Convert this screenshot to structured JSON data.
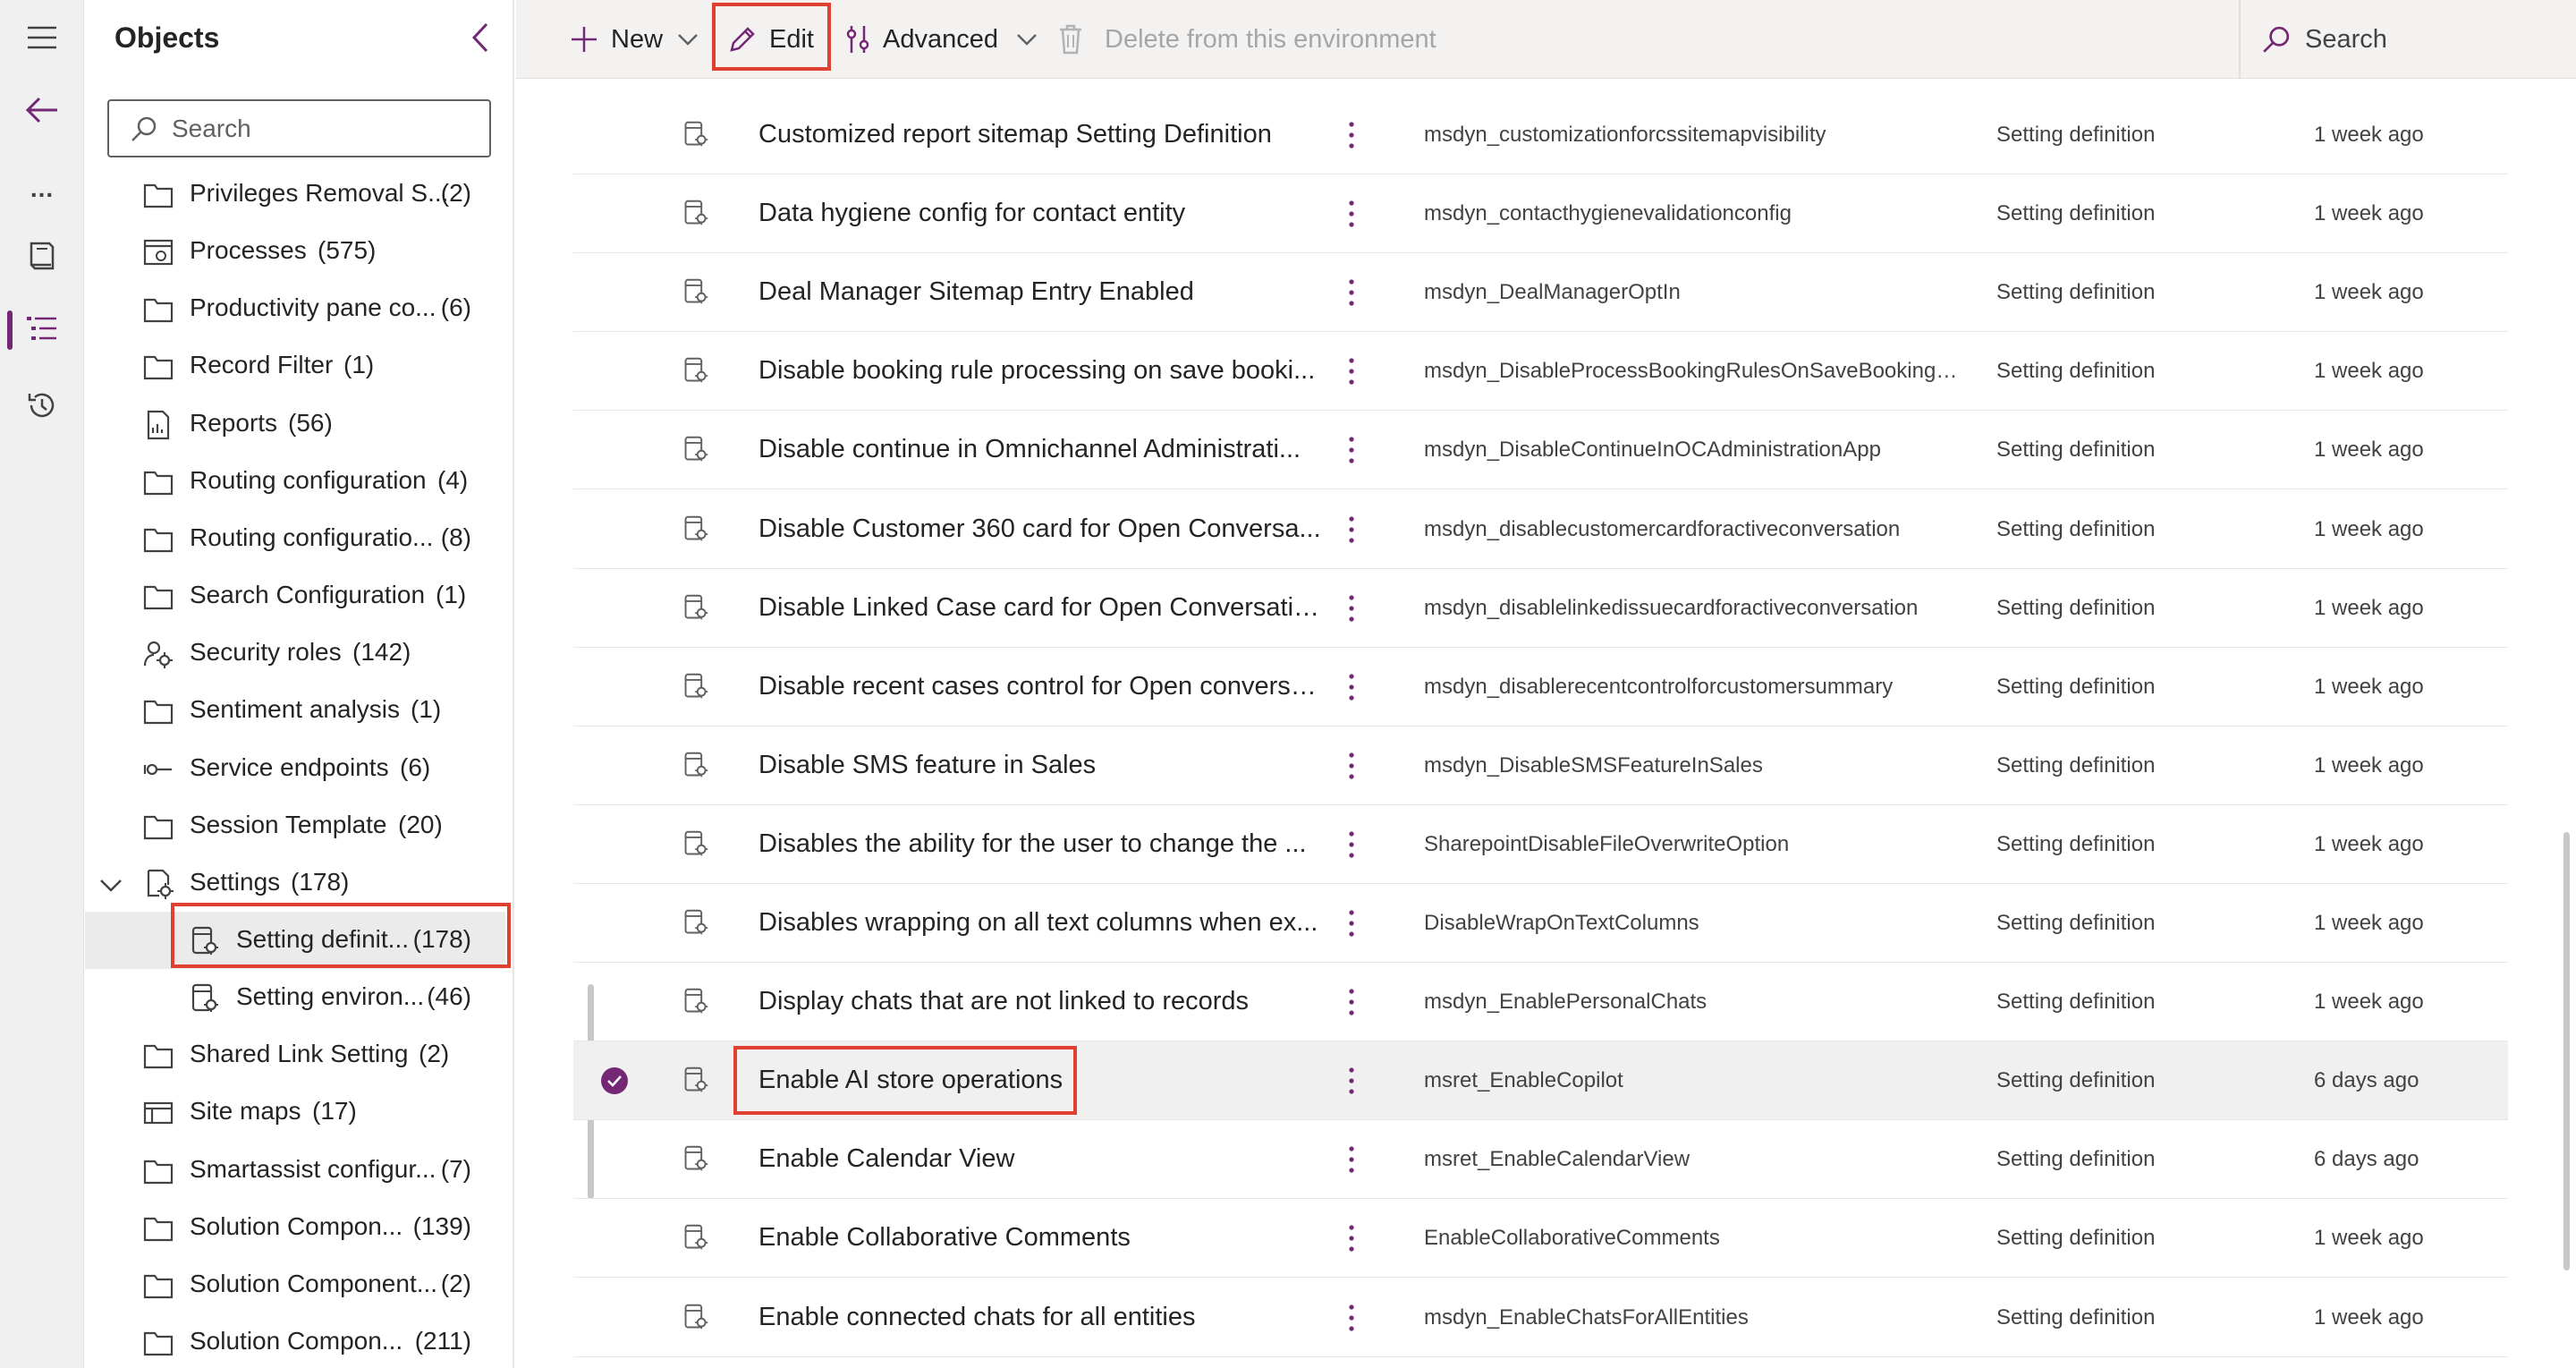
{
  "colors": {
    "accent": "#742774",
    "highlight": "#e0402f"
  },
  "rail": {
    "items": [
      {
        "icon": "hamburger-menu-icon"
      },
      {
        "icon": "back-arrow-icon"
      },
      {
        "icon": "more-options-icon",
        "label": "..."
      },
      {
        "icon": "book-icon"
      },
      {
        "icon": "object-list-icon",
        "active": true
      },
      {
        "icon": "history-icon"
      }
    ]
  },
  "objects": {
    "title": "Objects",
    "search_placeholder": "Search",
    "items": [
      {
        "label": "Privileges Removal S...",
        "count": "(2)",
        "icon": "folder-icon"
      },
      {
        "label": "Processes",
        "count": "(575)",
        "icon": "process-icon"
      },
      {
        "label": "Productivity pane co...",
        "count": "(6)",
        "icon": "folder-icon"
      },
      {
        "label": "Record Filter",
        "count": "(1)",
        "icon": "folder-icon"
      },
      {
        "label": "Reports",
        "count": "(56)",
        "icon": "report-icon"
      },
      {
        "label": "Routing configuration",
        "count": "(4)",
        "icon": "folder-icon"
      },
      {
        "label": "Routing configuratio...",
        "count": "(8)",
        "icon": "folder-icon"
      },
      {
        "label": "Search Configuration",
        "count": "(1)",
        "icon": "folder-icon"
      },
      {
        "label": "Security roles",
        "count": "(142)",
        "icon": "security-roles-icon"
      },
      {
        "label": "Sentiment analysis",
        "count": "(1)",
        "icon": "folder-icon"
      },
      {
        "label": "Service endpoints",
        "count": "(6)",
        "icon": "service-endpoint-icon"
      },
      {
        "label": "Session Template",
        "count": "(20)",
        "icon": "folder-icon"
      },
      {
        "label": "Settings",
        "count": "(178)",
        "icon": "settings-icon",
        "expanded": true
      },
      {
        "label": "Setting definit...",
        "count": "(178)",
        "icon": "setting-definition-icon",
        "child": true,
        "selected": true
      },
      {
        "label": "Setting environ...",
        "count": "(46)",
        "icon": "setting-definition-icon",
        "child": true
      },
      {
        "label": "Shared Link Setting",
        "count": "(2)",
        "icon": "folder-icon"
      },
      {
        "label": "Site maps",
        "count": "(17)",
        "icon": "sitemap-icon"
      },
      {
        "label": "Smartassist configur...",
        "count": "(7)",
        "icon": "folder-icon"
      },
      {
        "label": "Solution Compon...",
        "count": "(139)",
        "icon": "folder-icon"
      },
      {
        "label": "Solution Component...",
        "count": "(2)",
        "icon": "folder-icon"
      },
      {
        "label": "Solution Compon...",
        "count": "(211)",
        "icon": "folder-icon"
      }
    ]
  },
  "toolbar": {
    "new_label": "New",
    "edit_label": "Edit",
    "advanced_label": "Advanced",
    "delete_label": "Delete from this environment",
    "search_placeholder": "Search"
  },
  "grid": {
    "rows": [
      {
        "name": "Customized report sitemap Setting Definition",
        "schema": "msdyn_customizationforcssitemapvisibility",
        "type": "Setting definition",
        "modified": "1 week ago"
      },
      {
        "name": "Data hygiene config for contact entity",
        "schema": "msdyn_contacthygienevalidationconfig",
        "type": "Setting definition",
        "modified": "1 week ago"
      },
      {
        "name": "Deal Manager Sitemap Entry Enabled",
        "schema": "msdyn_DealManagerOptIn",
        "type": "Setting definition",
        "modified": "1 week ago"
      },
      {
        "name": "Disable booking rule processing on save booki...",
        "schema": "msdyn_DisableProcessBookingRulesOnSaveBookingFo...",
        "type": "Setting definition",
        "modified": "1 week ago"
      },
      {
        "name": "Disable continue in Omnichannel Administrati...",
        "schema": "msdyn_DisableContinueInOCAdministrationApp",
        "type": "Setting definition",
        "modified": "1 week ago"
      },
      {
        "name": "Disable Customer 360 card for Open Conversa...",
        "schema": "msdyn_disablecustomercardforactiveconversation",
        "type": "Setting definition",
        "modified": "1 week ago"
      },
      {
        "name": "Disable Linked Case card for Open Conversatio...",
        "schema": "msdyn_disablelinkedissuecardforactiveconversation",
        "type": "Setting definition",
        "modified": "1 week ago"
      },
      {
        "name": "Disable recent cases control for Open conversa...",
        "schema": "msdyn_disablerecentcontrolforcustomersummary",
        "type": "Setting definition",
        "modified": "1 week ago"
      },
      {
        "name": "Disable SMS feature in Sales",
        "schema": "msdyn_DisableSMSFeatureInSales",
        "type": "Setting definition",
        "modified": "1 week ago"
      },
      {
        "name": "Disables the ability for the user to change the ...",
        "schema": "SharepointDisableFileOverwriteOption",
        "type": "Setting definition",
        "modified": "1 week ago"
      },
      {
        "name": "Disables wrapping on all text columns when ex...",
        "schema": "DisableWrapOnTextColumns",
        "type": "Setting definition",
        "modified": "1 week ago"
      },
      {
        "name": "Display chats that are not linked to records",
        "schema": "msdyn_EnablePersonalChats",
        "type": "Setting definition",
        "modified": "1 week ago"
      },
      {
        "name": "Enable AI store operations",
        "schema": "msret_EnableCopilot",
        "type": "Setting definition",
        "modified": "6 days ago",
        "selected": true
      },
      {
        "name": "Enable Calendar View",
        "schema": "msret_EnableCalendarView",
        "type": "Setting definition",
        "modified": "6 days ago"
      },
      {
        "name": "Enable Collaborative Comments",
        "schema": "EnableCollaborativeComments",
        "type": "Setting definition",
        "modified": "1 week ago"
      },
      {
        "name": "Enable connected chats for all entities",
        "schema": "msdyn_EnableChatsForAllEntities",
        "type": "Setting definition",
        "modified": "1 week ago"
      }
    ]
  }
}
